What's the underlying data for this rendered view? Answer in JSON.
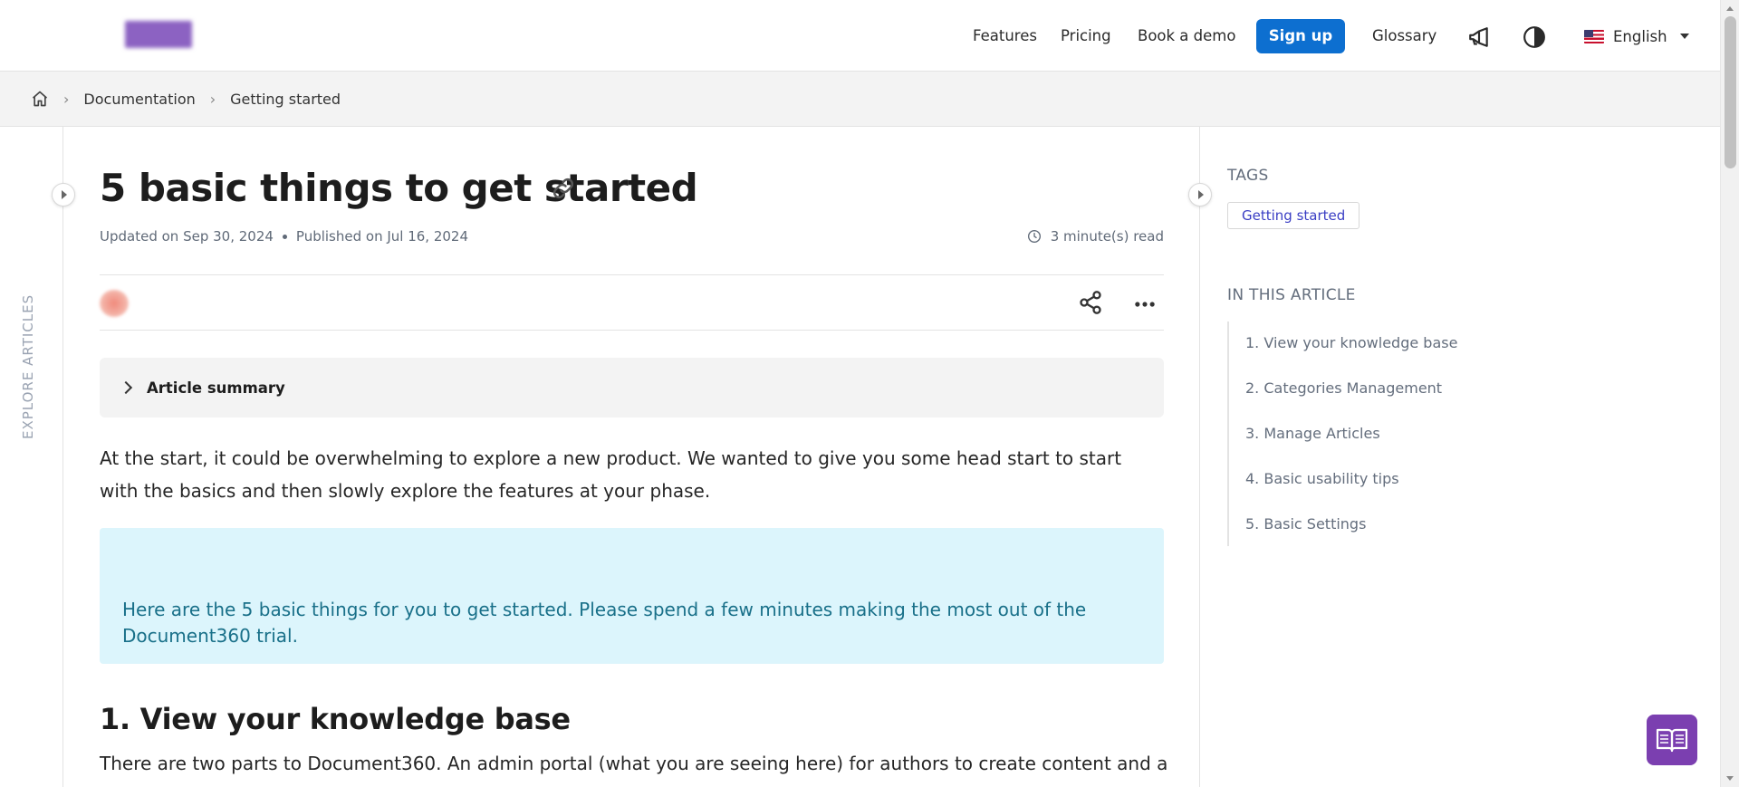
{
  "header": {
    "nav": {
      "features": "Features",
      "pricing": "Pricing",
      "book_demo": "Book a demo",
      "signup": "Sign up",
      "glossary": "Glossary"
    },
    "language": "English",
    "icons": [
      "megaphone-icon",
      "contrast-icon",
      "us-flag-icon",
      "caret-down-icon"
    ]
  },
  "breadcrumb": {
    "items": [
      "Documentation",
      "Getting started"
    ]
  },
  "left_rail": {
    "label": "EXPLORE ARTICLES"
  },
  "article": {
    "title": "5 basic things to get started",
    "updated": "Updated on Sep 30, 2024",
    "published": "Published on Jul 16, 2024",
    "read_time": "3 minute(s) read",
    "summary_label": "Article summary",
    "intro": "At the start, it could be overwhelming to explore a new product. We wanted to give you some head start to start with the basics and then slowly explore the features at your phase.",
    "callout": "Here are the 5 basic things for you to get started. Please spend a few minutes making the most out of the Document360 trial.",
    "section_1_heading": "1. View your knowledge base",
    "section_1_text": "There are two parts to Document360. An admin portal (what you are seeing here) for authors to create content and a"
  },
  "right_rail": {
    "tags_heading": "TAGS",
    "tag": "Getting started",
    "toc_heading": "IN THIS ARTICLE",
    "toc": [
      "1. View your knowledge base",
      "2. Categories Management",
      "3. Manage Articles",
      "4. Basic usability tips",
      "5. Basic Settings"
    ]
  },
  "colors": {
    "primary_button": "#0d6fd0",
    "callout_bg": "#dcf5fc",
    "callout_text": "#197089",
    "fab": "#7b3fb0",
    "tag_text": "#3a3ec4"
  }
}
